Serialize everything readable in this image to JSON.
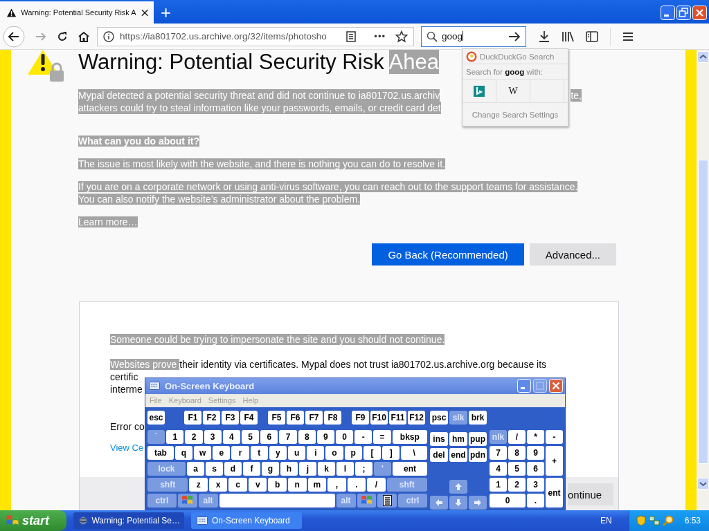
{
  "browser": {
    "tab": {
      "title": "Warning: Potential Security Risk A",
      "selected": true
    },
    "new_tab": "+",
    "url": "https://ia801702.us.archive.org/32/items/photosho",
    "page_actions": "•••",
    "search": {
      "value": "goog"
    },
    "search_popup": {
      "engine": "DuckDuckGo Search",
      "prompt": "Search for **goog** with:",
      "engines": [
        {
          "kind": "bing"
        },
        {
          "kind": "wikipedia",
          "label": "W"
        }
      ],
      "settings": "Change Search Settings"
    }
  },
  "page": {
    "heading": [
      {
        "text": "Warning: Potential Security Risk ",
        "highlighted": false
      },
      {
        "text": "Ahea",
        "highlighted": true
      }
    ],
    "intro_lines": [
      {
        "text": "Mypal detected a potential security threat and did not continue to ia801702.us.archiv",
        "end": "te,"
      },
      {
        "text": "attackers could try to steal information like your passwords, emails, or credit card det"
      }
    ],
    "question": "What can you do about it?",
    "paragraphs": [
      "The issue is most likely with the website, and there is nothing you can do to resolve it.",
      "If you are on a corporate network or using anti-virus software, you can reach out to the support teams for assistance. You can also notify the website’s administrator about the problem."
    ],
    "learn_more": "Learn more…",
    "buttons": [
      {
        "label": "Go Back (Recommended)",
        "kind": "primary"
      },
      {
        "label": "Advanced...",
        "kind": "secondary"
      }
    ],
    "advanced": {
      "warning": "Someone could be trying to impersonate the site and you should not continue.",
      "cert_line": [
        {
          "text": "Websites prove ",
          "highlighted": true
        },
        {
          "text": "their identity via certificates. Mypal does not trust ia801702.us.archive.org because its",
          "highlighted": false
        }
      ],
      "cert_fragments": [
        "certific",
        "interme"
      ],
      "error_code": "Error co",
      "view_link": "View Ce",
      "continue": "ontinue"
    }
  },
  "keyboard": {
    "title": "On-Screen Keyboard",
    "menu": [
      {
        "label": "File",
        "disabled": true
      },
      {
        "label": "Keyboard",
        "disabled": true
      },
      {
        "label": "Settings",
        "disabled": true
      },
      {
        "label": "Help",
        "disabled": true
      }
    ],
    "function_groups": [
      [
        {
          "label": "esc",
          "kind": "key"
        }
      ],
      [
        {
          "label": "F1",
          "kind": "key"
        },
        {
          "label": "F2",
          "kind": "key"
        },
        {
          "label": "F3",
          "kind": "key"
        },
        {
          "label": "F4",
          "kind": "key"
        }
      ],
      [
        {
          "label": "F5",
          "kind": "key"
        },
        {
          "label": "F6",
          "kind": "key"
        },
        {
          "label": "F7",
          "kind": "key"
        },
        {
          "label": "F8",
          "kind": "key"
        }
      ],
      [
        {
          "label": "F9",
          "kind": "key"
        },
        {
          "label": "F10",
          "kind": "key"
        },
        {
          "label": "F11",
          "kind": "key"
        },
        {
          "label": "F12",
          "kind": "key"
        }
      ]
    ],
    "main_rows": [
      [
        {
          "label": "`",
          "kind": "mod"
        },
        {
          "label": "1",
          "kind": "key"
        },
        {
          "label": "2",
          "kind": "key"
        },
        {
          "label": "3",
          "kind": "key"
        },
        {
          "label": "4",
          "kind": "key"
        },
        {
          "label": "5",
          "kind": "key"
        },
        {
          "label": "6",
          "kind": "key"
        },
        {
          "label": "7",
          "kind": "key"
        },
        {
          "label": "8",
          "kind": "key"
        },
        {
          "label": "9",
          "kind": "key"
        },
        {
          "label": "0",
          "kind": "key"
        },
        {
          "label": "-",
          "kind": "key"
        },
        {
          "label": "=",
          "kind": "key"
        },
        {
          "label": "bksp",
          "kind": "wide"
        }
      ],
      [
        {
          "label": "tab",
          "kind": "half"
        },
        {
          "label": "q",
          "kind": "key"
        },
        {
          "label": "w",
          "kind": "key"
        },
        {
          "label": "e",
          "kind": "key"
        },
        {
          "label": "r",
          "kind": "key"
        },
        {
          "label": "t",
          "kind": "key"
        },
        {
          "label": "y",
          "kind": "key"
        },
        {
          "label": "u",
          "kind": "key"
        },
        {
          "label": "i",
          "kind": "key"
        },
        {
          "label": "o",
          "kind": "key"
        },
        {
          "label": "p",
          "kind": "key"
        },
        {
          "label": "[",
          "kind": "key"
        },
        {
          "label": "]",
          "kind": "key"
        },
        {
          "label": "\\",
          "kind": "half"
        }
      ],
      [
        {
          "label": "lock",
          "kind": "modwide"
        },
        {
          "label": "a",
          "kind": "key"
        },
        {
          "label": "s",
          "kind": "key"
        },
        {
          "label": "d",
          "kind": "key"
        },
        {
          "label": "f",
          "kind": "key"
        },
        {
          "label": "g",
          "kind": "key"
        },
        {
          "label": "h",
          "kind": "key"
        },
        {
          "label": "j",
          "kind": "key"
        },
        {
          "label": "k",
          "kind": "key"
        },
        {
          "label": "l",
          "kind": "key"
        },
        {
          "label": ";",
          "kind": "key"
        },
        {
          "label": "'",
          "kind": "mod"
        },
        {
          "label": "ent",
          "kind": "wide"
        }
      ],
      [
        {
          "label": "shft",
          "kind": "modwide"
        },
        {
          "label": "z",
          "kind": "key"
        },
        {
          "label": "x",
          "kind": "key"
        },
        {
          "label": "c",
          "kind": "key"
        },
        {
          "label": "v",
          "kind": "key"
        },
        {
          "label": "b",
          "kind": "key"
        },
        {
          "label": "n",
          "kind": "key"
        },
        {
          "label": "m",
          "kind": "key"
        },
        {
          "label": ",",
          "kind": "key"
        },
        {
          "label": ".",
          "kind": "key"
        },
        {
          "label": "/",
          "kind": "key"
        },
        {
          "label": "shft",
          "kind": "modwide"
        }
      ],
      [
        {
          "label": "ctrl",
          "kind": "modhalf"
        },
        {
          "kind": "win"
        },
        {
          "label": "alt",
          "kind": "mod"
        },
        {
          "kind": "space"
        },
        {
          "label": "alt",
          "kind": "mod"
        },
        {
          "kind": "win"
        },
        {
          "kind": "menu"
        },
        {
          "label": "ctrl",
          "kind": "modhalf"
        }
      ]
    ],
    "nav_keys": [
      {
        "label": "psc",
        "kind": "key"
      },
      {
        "label": "slk",
        "kind": "mod"
      },
      {
        "label": "brk",
        "kind": "key"
      },
      {
        "label": "ins",
        "kind": "key"
      },
      {
        "label": "hm",
        "kind": "key"
      },
      {
        "label": "pup",
        "kind": "key"
      },
      {
        "label": "del",
        "kind": "key"
      },
      {
        "label": "end",
        "kind": "key"
      },
      {
        "label": "pdn",
        "kind": "key"
      },
      {
        "kind": "up"
      },
      {
        "kind": "left"
      },
      {
        "kind": "down"
      },
      {
        "kind": "right"
      }
    ],
    "numpad_keys": [
      {
        "label": "nlk",
        "kind": "mod"
      },
      {
        "label": "/",
        "kind": "key"
      },
      {
        "label": "*",
        "kind": "key"
      },
      {
        "label": "-",
        "kind": "key"
      },
      {
        "label": "7",
        "kind": "key"
      },
      {
        "label": "8",
        "kind": "key"
      },
      {
        "label": "9",
        "kind": "key"
      },
      {
        "label": "+",
        "kind": "tall"
      },
      {
        "label": "4",
        "kind": "key"
      },
      {
        "label": "5",
        "kind": "key"
      },
      {
        "label": "6",
        "kind": "key"
      },
      {
        "label": "1",
        "kind": "key"
      },
      {
        "label": "2",
        "kind": "key"
      },
      {
        "label": "3",
        "kind": "key"
      },
      {
        "label": "ent",
        "kind": "tall"
      },
      {
        "label": "0",
        "kind": "zero"
      },
      {
        "label": ".",
        "kind": "key"
      }
    ]
  },
  "taskbar": {
    "start": "start",
    "tasks": [
      {
        "label": "Warning: Potential Se…",
        "kind": "browser",
        "selected": true
      },
      {
        "label": "On-Screen Keyboard",
        "kind": "keyboard",
        "selected": false
      }
    ],
    "language": "EN",
    "clock": "6:53"
  }
}
